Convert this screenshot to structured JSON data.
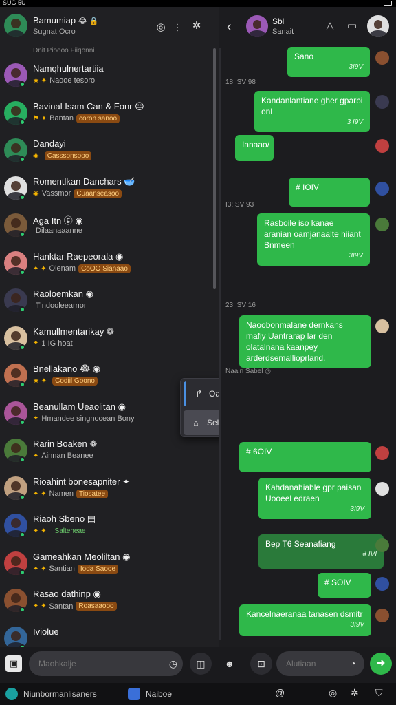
{
  "status_bar": {
    "time": "SUG 5U"
  },
  "me": {
    "name": "Bamumiap",
    "badges": "😂 🔒",
    "status": "Sugnat Ocro"
  },
  "section": {
    "label": "Dnit   Pioooo Fiiqonni"
  },
  "chats": [
    {
      "name": "Namqhulnertartiia",
      "meta": "Naooe tesoro",
      "stars": "★ ✦",
      "tag": "",
      "tag_style": "green",
      "avatar": "#9b59b6"
    },
    {
      "name": "Bavinal Isam  Can & Fonr 😐",
      "meta": "Bantan",
      "stars": "⚑ ✦",
      "tag": "coron sanoo",
      "tag_style": "orange",
      "avatar": "#27ae60"
    },
    {
      "name": "Dandayi",
      "meta": "",
      "stars": "◉",
      "tag": "Casssonsooo",
      "tag_style": "orange",
      "avatar": "#2e8b57"
    },
    {
      "name": "Romentlkan Danchars 🥣",
      "meta": "Vassmor",
      "stars": "◉",
      "tag": "Cuaanseasoo",
      "tag_style": "orange",
      "avatar": "#e0e0e0"
    },
    {
      "name": "Aga Itn  ⓖ ◉",
      "meta": "Dilaanaaanne",
      "stars": "",
      "tag": "",
      "tag_style": "green",
      "avatar": "#7a5a3a"
    },
    {
      "name": "Hanktar Raepeorala ◉",
      "meta": "Olenam",
      "stars": "✦ ✦",
      "tag": "CoOO Sianaao",
      "tag_style": "orange",
      "avatar": "#d98080"
    },
    {
      "name": "Raoloemkan ◉",
      "meta": "Tindooleearnor",
      "stars": "",
      "tag": "",
      "tag_style": "green",
      "avatar": "#3a3a50"
    },
    {
      "name": "Kamullmentarikay ❁",
      "meta": "1 IG hoat",
      "stars": "✦",
      "tag": "",
      "tag_style": "green",
      "avatar": "#d8c0a0"
    },
    {
      "name": "Bnellakano 😂 ◉",
      "meta": "",
      "stars": "★ ✦",
      "tag": "Codiil Goono",
      "tag_style": "orange",
      "avatar": "#c07050"
    },
    {
      "name": "Beanullam Ueaolitan ◉",
      "meta": "Hmandee singnocean Bony",
      "stars": "✦",
      "tag": "",
      "tag_style": "green",
      "avatar": "#aa5599"
    },
    {
      "name": "Rarin Boaken ❁",
      "meta": "Ainnan Beanee",
      "stars": "✦",
      "tag": "",
      "tag_style": "green",
      "avatar": "#4a7a3a"
    },
    {
      "name": "Rioahint bonesapniter ✦",
      "meta": "Namen",
      "stars": "✦ ✦",
      "tag": "Tiosatee",
      "tag_style": "orange",
      "avatar": "#c0a080"
    },
    {
      "name": "Riaoh Sbeno ▤",
      "meta": "",
      "stars": "✦ ✦",
      "tag": "Salteneae",
      "tag_style": "green",
      "avatar": "#3050a0"
    },
    {
      "name": "Gameahkan Meoliltan ◉",
      "meta": "Santian",
      "stars": "✦ ✦",
      "tag": "Ioda Saooe",
      "tag_style": "orange",
      "avatar": "#c04040"
    },
    {
      "name": "Rasao dathinp ◉",
      "meta": "Santan",
      "stars": "✦ ✦",
      "tag": "Roasaaooo",
      "tag_style": "orange",
      "avatar": "#8a5030"
    },
    {
      "name": "Iviolue",
      "meta": "",
      "stars": "",
      "tag": "",
      "tag_style": "green",
      "avatar": "#336699"
    }
  ],
  "popup": {
    "option1": "Oan",
    "option2": "Selanolis"
  },
  "peer": {
    "name": "Sbl",
    "status": "Sanait"
  },
  "messages": [
    {
      "text": "Sano",
      "time": "3I9V",
      "style": "green"
    },
    {
      "day": "18: SV 98"
    },
    {
      "text": "Kandanlantiane gher gparbi onl",
      "time": "3 I9V",
      "style": "green"
    },
    {
      "text": "Ianaao/",
      "time": "",
      "style": "green"
    },
    {
      "day": "I3: SV 93"
    },
    {
      "text": "Rasboile iso kanae aranian oamjanaalte hiiant Bnmeen",
      "time": "3I9V",
      "style": "green"
    },
    {
      "text": "# IOIV",
      "time": "",
      "style": "green"
    },
    {
      "day": "23: SV 16"
    },
    {
      "text": "Naoobonmalane dernkans mafiy Uantrarap lar den olatalnana kaanpey arderdsemallioprland.",
      "time": "",
      "style": "green"
    },
    {
      "day": "Naain Sabel ◎"
    },
    {
      "text": "# 6OIV",
      "time": "",
      "style": "green"
    },
    {
      "text": "Kahdanahiable gpr paisan Uooeel edraen",
      "time": "3I9V",
      "style": "green"
    },
    {
      "text": "Bep T6 Seanafiang",
      "time": "# IVI",
      "style": "dark"
    },
    {
      "text": "# SOIV",
      "time": "",
      "style": "green"
    },
    {
      "text": "Kancelnaeranaa tanasen dsmitr",
      "time": "3I9V",
      "style": "green"
    }
  ],
  "composer": {
    "left_placeholder": "Maohkalje",
    "right_placeholder": "Alutiaan"
  },
  "taskbar": {
    "app1": "Niunbormanlisaners",
    "app2": "Naiboe"
  },
  "colors": {
    "accent": "#2fb84a",
    "bg": "#1f1f22"
  }
}
